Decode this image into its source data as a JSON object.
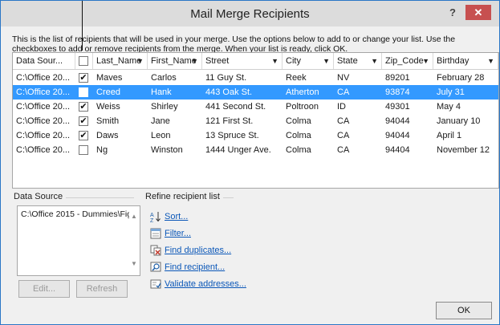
{
  "window": {
    "title": "Mail Merge Recipients",
    "help_glyph": "?",
    "close_glyph": "✕"
  },
  "intro": "This is the list of recipients that will be used in your merge.  Use the options below to add to or change your list.  Use the checkboxes to add or remove recipients from the merge.  When your list is ready, click OK.",
  "table": {
    "columns": [
      "Data Sour...",
      "",
      "Last_Name",
      "First_Name",
      "Street",
      "City",
      "State",
      "Zip_Code",
      "Birthday"
    ],
    "dropdown_glyph": "▼",
    "rows": [
      {
        "source": "C:\\Office 20...",
        "checked": "✔",
        "last": "Maves",
        "first": "Carlos",
        "street": "11 Guy St.",
        "city": "Reek",
        "state": "NV",
        "zip": "89201",
        "birthday": "February 28"
      },
      {
        "source": "C:\\Office 20...",
        "checked": "",
        "last": "Creed",
        "first": "Hank",
        "street": "443 Oak St.",
        "city": "Atherton",
        "state": "CA",
        "zip": "93874",
        "birthday": "July 31"
      },
      {
        "source": "C:\\Office 20...",
        "checked": "✔",
        "last": "Weiss",
        "first": "Shirley",
        "street": "441 Second St.",
        "city": "Poltroon",
        "state": "ID",
        "zip": "49301",
        "birthday": "May 4"
      },
      {
        "source": "C:\\Office 20...",
        "checked": "✔",
        "last": "Smith",
        "first": "Jane",
        "street": "121 First St.",
        "city": "Colma",
        "state": "CA",
        "zip": "94044",
        "birthday": "January 10"
      },
      {
        "source": "C:\\Office 20...",
        "checked": "✔",
        "last": "Daws",
        "first": "Leon",
        "street": "13 Spruce St.",
        "city": "Colma",
        "state": "CA",
        "zip": "94044",
        "birthday": "April 1"
      },
      {
        "source": "C:\\Office 20...",
        "checked": "",
        "last": "Ng",
        "first": "Winston",
        "street": "1444 Unger Ave.",
        "city": "Colma",
        "state": "CA",
        "zip": "94404",
        "birthday": "November 12"
      }
    ],
    "selected_row_color": "#3399ff"
  },
  "data_source": {
    "label": "Data Source",
    "item": "C:\\Office 2015 - Dummies\\Fig",
    "scroll_up": "▲",
    "scroll_down": "▼",
    "edit_label": "Edit...",
    "refresh_label": "Refresh"
  },
  "refine": {
    "label": "Refine recipient list",
    "items": [
      {
        "icon": "sort-icon",
        "label": "Sort..."
      },
      {
        "icon": "filter-icon",
        "label": "Filter..."
      },
      {
        "icon": "find-duplicates-icon",
        "label": "Find duplicates..."
      },
      {
        "icon": "find-recipient-icon",
        "label": "Find recipient..."
      },
      {
        "icon": "validate-addresses-icon",
        "label": "Validate addresses..."
      }
    ]
  },
  "ok_label": "OK",
  "colors": {
    "close": "#c75050",
    "link": "#0b57b8",
    "border": "#2a76c6"
  }
}
